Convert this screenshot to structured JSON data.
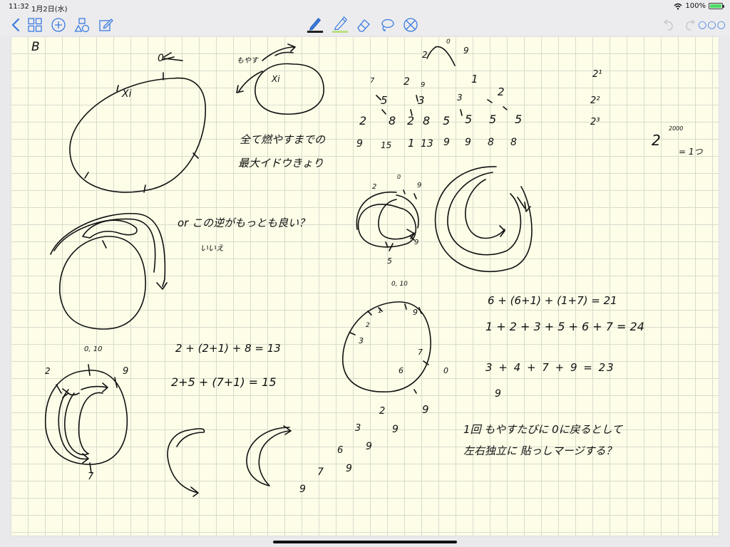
{
  "status_bar": {
    "time": "11:32",
    "date": "1月2日(水)",
    "battery_percent": "100%"
  },
  "toolbar": {
    "accent_color": "#3b7be0",
    "active_tool": "pen",
    "pen_color": "#111111",
    "highlighter_color": "#b6e07a",
    "icons": [
      "back-chevron-icon",
      "grid-icon",
      "add-icon",
      "shapes-icon",
      "edit-icon",
      "pen-icon",
      "highlighter-icon",
      "eraser-icon",
      "lasso-icon",
      "disable-icon",
      "undo-icon",
      "redo-icon",
      "more-icon"
    ]
  },
  "notes": {
    "page_label": "B",
    "top_zero": "0",
    "xi_label": "Xi",
    "small_top_label": "もやす",
    "xi2_label": "Xi",
    "jp_line1": "全て燃やすまでの",
    "jp_line2": "最大イドウきょり",
    "or_line": "or この逆がもっとも良い？",
    "iie": "いいえ",
    "eq1": "2 + (2+1) + 8 = 13",
    "eq2": "2+5 + (7+1) = 15",
    "sum1": "6 + (6+1) + (1+7) = 21",
    "sum2": "1 + 2 + 3 + 5 + 6 + 7 = 24",
    "sum3": "3 + 4 + 7 + 9 = 23",
    "nine_below": "9",
    "power_2": "2",
    "power_exp": "2000",
    "power_rhs": "= 1つ",
    "pow_list": [
      "2¹",
      "2²",
      "2³"
    ],
    "tree_root_left": "2",
    "tree_root_mid": "0",
    "tree_root_right": "9",
    "tree_l2": [
      "7",
      "2",
      "9",
      "1",
      "2"
    ],
    "tree_l3": [
      "5",
      "3",
      "3"
    ],
    "tree_row4": [
      "2",
      "8",
      "2",
      "8",
      "5",
      "5",
      "5",
      "5"
    ],
    "tree_row5": [
      "9",
      "15",
      "1",
      "13",
      "9",
      "9",
      "8",
      "8"
    ],
    "small_circle_labels": [
      "2",
      "0",
      "9",
      "9",
      "5"
    ],
    "clock_labels": [
      "0, 10",
      "1",
      "9",
      "2",
      "3",
      "7",
      "6",
      "0"
    ],
    "bottom_left_labels": [
      "0, 10",
      "2",
      "9",
      "7"
    ],
    "staircase": [
      "2",
      "9",
      "3",
      "9",
      "6",
      "9",
      "9",
      "7",
      "9"
    ],
    "jp_bottom1": "1回 もやすたびに 0に戻るとして",
    "jp_bottom2": "左右独立に 貼っしマージする？"
  }
}
